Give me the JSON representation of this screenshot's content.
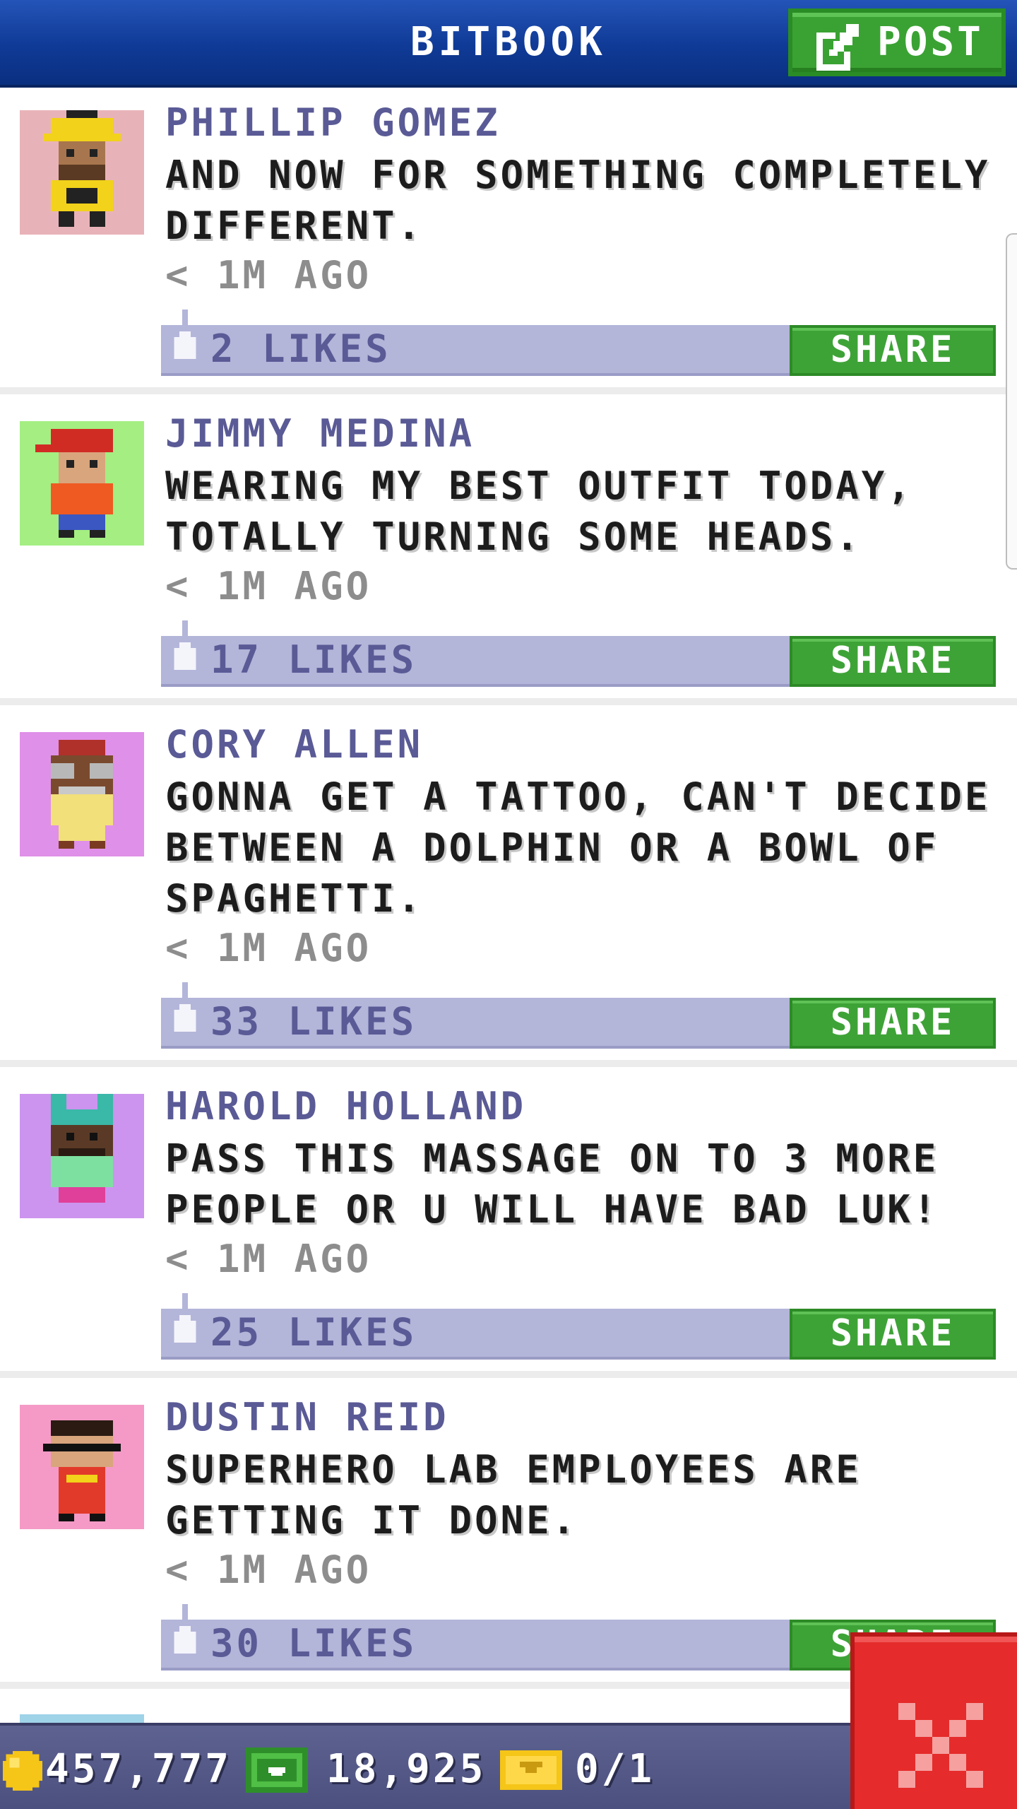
{
  "header": {
    "title": "BITBOOK",
    "post_label": "POST"
  },
  "posts": [
    {
      "author": "PHILLIP GOMEZ",
      "lines": [
        "AND NOW FOR SOMETHING COMPLETELY",
        "DIFFERENT."
      ],
      "time": "< 1M AGO",
      "likes": "2 LIKES",
      "share_label": "SHARE",
      "avatar_bg": "#e8b3b8"
    },
    {
      "author": "JIMMY MEDINA",
      "lines": [
        "WEARING MY BEST OUTFIT TODAY,",
        "TOTALLY TURNING SOME HEADS."
      ],
      "time": "< 1M AGO",
      "likes": "17 LIKES",
      "share_label": "SHARE",
      "avatar_bg": "#a4ee82"
    },
    {
      "author": "CORY ALLEN",
      "lines": [
        "GONNA GET A TATTOO, CAN'T DECIDE",
        "BETWEEN A DOLPHIN OR A BOWL OF",
        "SPAGHETTI."
      ],
      "time": "< 1M AGO",
      "likes": "33 LIKES",
      "share_label": "SHARE",
      "avatar_bg": "#df90e8"
    },
    {
      "author": "HAROLD HOLLAND",
      "lines": [
        "PASS THIS MASSAGE ON TO 3 MORE",
        "PEOPLE OR U WILL HAVE BAD LUK!"
      ],
      "time": "< 1M AGO",
      "likes": "25 LIKES",
      "share_label": "SHARE",
      "avatar_bg": "#cc94ee"
    },
    {
      "author": "DUSTIN REID",
      "lines": [
        "SUPERHERO LAB EMPLOYEES ARE",
        "GETTING IT DONE."
      ],
      "time": "< 1M AGO",
      "likes": "30 LIKES",
      "share_label": "SHARE",
      "avatar_bg": "#f59ac6"
    }
  ],
  "bottom_bar": {
    "coins": "457,777",
    "bux": "18,925",
    "tickets": "0/1"
  },
  "colors": {
    "header_blue": "#103c98",
    "post_green": "#3aa233",
    "likes_bar": "#b3b5d9",
    "author_text": "#5a5a96",
    "close_red": "#e52b2b"
  },
  "icons": {
    "post": "edit-icon",
    "like": "thumbs-up-icon",
    "coin": "coin-icon",
    "bux": "bux-icon",
    "ticket": "ticket-icon",
    "close": "close-icon"
  }
}
